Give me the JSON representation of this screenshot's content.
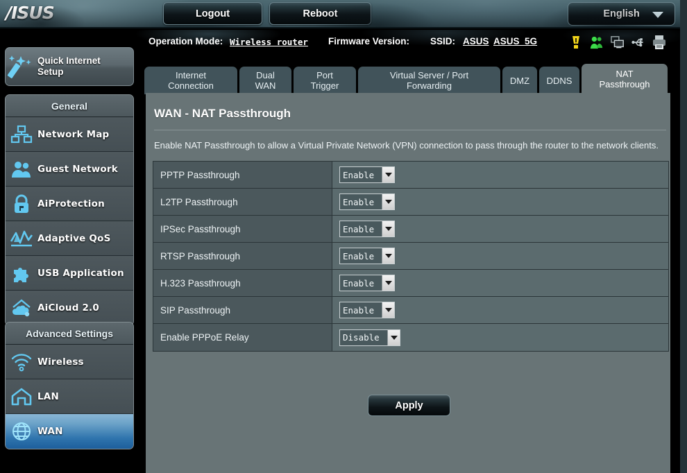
{
  "header": {
    "logo": "/ISUS",
    "logout_label": "Logout",
    "reboot_label": "Reboot",
    "language": "English",
    "caret_icon": "chevron-down-icon"
  },
  "infobar": {
    "operation_mode_label": "Operation Mode:",
    "operation_mode_value": "Wireless router",
    "firmware_label": "Firmware Version:",
    "ssid_label": "SSID:",
    "ssid_1": "ASUS",
    "ssid_2": "ASUS_5G",
    "status_icons": [
      {
        "name": "alert-icon",
        "color": "#f2d41a"
      },
      {
        "name": "clients-users-icon",
        "color": "#3ddd4a"
      },
      {
        "name": "monitor-icon",
        "color": "#9aa5a8"
      },
      {
        "name": "usb-icon",
        "color": "#9aa5a8"
      },
      {
        "name": "printer-icon",
        "color": "#9aa5a8"
      }
    ]
  },
  "sidebar": {
    "quick_setup": {
      "label_line1": "Quick Internet",
      "label_line2": "Setup",
      "icon": "magic-wand-icon"
    },
    "general": {
      "title": "General",
      "items": [
        {
          "label": "Network Map",
          "icon": "network-map-icon",
          "active": false
        },
        {
          "label": "Guest Network",
          "icon": "guest-network-icon",
          "active": false
        },
        {
          "label": "AiProtection",
          "icon": "lock-shield-icon",
          "active": false
        },
        {
          "label": "Adaptive QoS",
          "icon": "qos-chart-icon",
          "active": false
        },
        {
          "label": "USB Application",
          "icon": "puzzle-icon",
          "active": false
        },
        {
          "label": "AiCloud 2.0",
          "icon": "cloud-house-icon",
          "active": false
        }
      ]
    },
    "advanced": {
      "title": "Advanced Settings",
      "items": [
        {
          "label": "Wireless",
          "icon": "wifi-icon",
          "active": false
        },
        {
          "label": "LAN",
          "icon": "house-icon",
          "active": false
        },
        {
          "label": "WAN",
          "icon": "globe-icon",
          "active": true
        }
      ]
    }
  },
  "tabs": [
    {
      "label": "Internet\nConnection",
      "line1": "Internet",
      "line2": "Connection",
      "active": false
    },
    {
      "label": "Dual WAN",
      "line1": "Dual",
      "line2": "WAN",
      "active": false
    },
    {
      "label": "Port Trigger",
      "line1": "Port",
      "line2": "Trigger",
      "active": false
    },
    {
      "label": "Virtual Server / Port Forwarding",
      "line1": "Virtual Server / Port",
      "line2": "Forwarding",
      "active": false
    },
    {
      "label": "DMZ",
      "line1": "DMZ",
      "line2": "",
      "active": false
    },
    {
      "label": "DDNS",
      "line1": "DDNS",
      "line2": "",
      "active": false
    },
    {
      "label": "NAT Passthrough",
      "line1": "NAT",
      "line2": "Passthrough",
      "active": true
    }
  ],
  "panel": {
    "title": "WAN - NAT Passthrough",
    "description": "Enable NAT Passthrough to allow a Virtual Private Network (VPN) connection to pass through the router to the network clients.",
    "rows": [
      {
        "label": "PPTP Passthrough",
        "value": "Enable"
      },
      {
        "label": "L2TP Passthrough",
        "value": "Enable"
      },
      {
        "label": "IPSec Passthrough",
        "value": "Enable"
      },
      {
        "label": "RTSP Passthrough",
        "value": "Enable"
      },
      {
        "label": "H.323 Passthrough",
        "value": "Enable"
      },
      {
        "label": "SIP Passthrough",
        "value": "Enable"
      },
      {
        "label": "Enable PPPoE Relay",
        "value": "Disable"
      }
    ],
    "apply_label": "Apply"
  },
  "colors": {
    "panel_bg": "#687476",
    "row_label_bg": "#4b585c",
    "row_value_bg": "#5b6b6e",
    "accent_blue": "#2f74ad",
    "icon_cyan": "#62c8f0"
  }
}
